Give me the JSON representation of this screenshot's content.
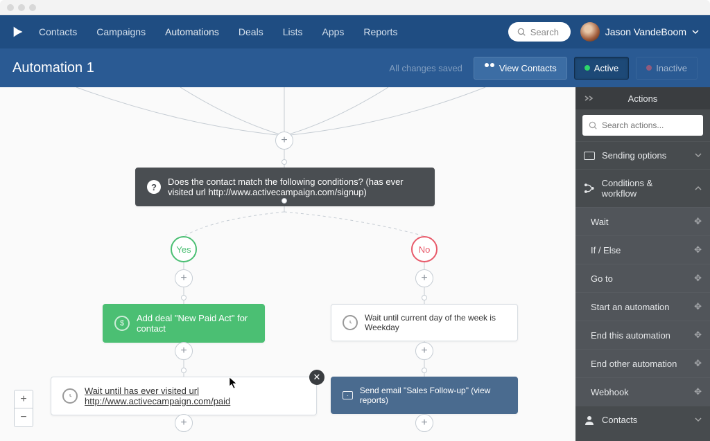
{
  "chrome": {
    "dots": 3
  },
  "nav": {
    "items": [
      {
        "label": "Contacts"
      },
      {
        "label": "Campaigns"
      },
      {
        "label": "Automations",
        "active": true
      },
      {
        "label": "Deals"
      },
      {
        "label": "Lists"
      },
      {
        "label": "Apps"
      },
      {
        "label": "Reports"
      }
    ],
    "search_placeholder": "Search",
    "user_name": "Jason VandeBoom"
  },
  "subheader": {
    "title": "Automation 1",
    "saved_text": "All changes saved",
    "view_contacts": "View Contacts",
    "active": "Active",
    "inactive": "Inactive"
  },
  "sidebar": {
    "title": "Actions",
    "search_placeholder": "Search actions...",
    "sections": {
      "sending": {
        "label": "Sending options"
      },
      "conditions": {
        "label": "Conditions & workflow"
      },
      "contacts": {
        "label": "Contacts"
      }
    },
    "conditions_items": [
      "Wait",
      "If / Else",
      "Go to",
      "Start an automation",
      "End this automation",
      "End other automation",
      "Webhook"
    ]
  },
  "flow": {
    "condition_text": "Does the contact match the following conditions? (has ever visited url http://www.activecampaign.com/signup)",
    "yes": "Yes",
    "no": "No",
    "add_deal": "Add deal \"New Paid Act\" for contact",
    "wait_weekday": "Wait until current day of the week is Weekday",
    "wait_visited": "Wait until has ever visited url http://www.activecampaign.com/paid",
    "send_email": "Send email \"Sales Follow-up\" (view reports)"
  },
  "zoom": {
    "plus": "+",
    "minus": "−"
  }
}
